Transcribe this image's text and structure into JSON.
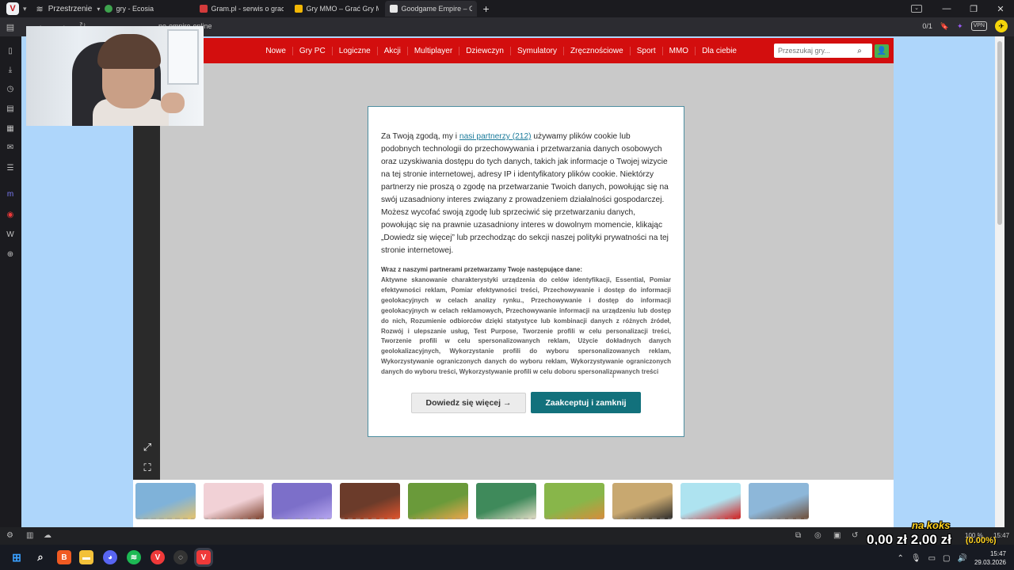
{
  "browser": {
    "workspace_label": "Przestrzenie",
    "tabs": [
      {
        "title": "gry - Ecosia",
        "color": "#3ea44e"
      },
      {
        "title": "Gram.pl - serwis o grach",
        "color": "#d33b3b"
      },
      {
        "title": "Gry MMO – Grać Gry MMO",
        "color": "#f2b705"
      },
      {
        "title": "Goodgame Empire – Grać C",
        "color": "#5a5a5a"
      }
    ],
    "url": "ne-empire-online",
    "tab_counter": "0/1",
    "vpn_label": "VPN"
  },
  "site": {
    "nav": [
      "Nowe",
      "Gry PC",
      "Logiczne",
      "Akcji",
      "Multiplayer",
      "Dziewczyn",
      "Symulatory",
      "Zręcznościowe",
      "Sport",
      "MMO",
      "Dla ciebie"
    ],
    "search_placeholder": "Przeszukaj gry..."
  },
  "cookie": {
    "intro_before": "Za Twoją zgodą, my i ",
    "partners_link": "nasi partnerzy (212)",
    "intro_after": " używamy plików cookie lub podobnych technologii do przechowywania i przetwarzania danych osobowych oraz uzyskiwania dostępu do tych danych, takich jak informacje o Twojej wizycie na tej stronie internetowej, adresy IP i identyfikatory plików cookie. Niektórzy partnerzy nie proszą o zgodę na przetwarzanie Twoich danych, powołując się na swój uzasadniony interes związany z prowadzeniem działalności gospodarczej. Możesz wycofać swoją zgodę lub sprzeciwić się przetwarzaniu danych, powołując się na prawnie uzasadniony interes w dowolnym momencie, klikając „Dowiedz się więcej” lub przechodząc do sekcji naszej polityki prywatności na tej stronie internetowej.",
    "data_title": "Wraz z naszymi partnerami przetwarzamy Twoje następujące dane:",
    "data_list": "Aktywne skanowanie charakterystyki urządzenia do celów identyfikacji, Essential, Pomiar efektywności reklam, Pomiar efektywności treści, Przechowywanie i dostęp do informacji geolokacyjnych w celach analizy rynku., Przechowywanie i dostęp do informacji geolokacyjnych w celach reklamowych, Przechowywanie informacji na urządzeniu lub dostęp do nich, Rozumienie odbiorców dzięki statystyce lub kombinacji danych z różnych źródeł, Rozwój i ulepszanie usług, Test Purpose, Tworzenie profili w celu personalizacji treści, Tworzenie profili w celu spersonalizowanych reklam, Użycie dokładnych danych geolokalizacyjnych, Wykorzystanie profili do wyboru spersonalizowanych reklam, Wykorzystywanie ograniczonych danych do wyboru reklam, Wykorzystywanie ograniczonych danych do wyboru treści, Wykorzystywanie profili w celu doboru spersonalizowanych treści",
    "btn_more": "Dowiedz się więcej →",
    "btn_accept": "Zaakceptuj i zamknij"
  },
  "thumbs": [
    {
      "color": "#7fb2d9",
      "accent": "#e9c46a"
    },
    {
      "color": "#f1d1d6",
      "accent": "#7b3f2a"
    },
    {
      "color": "#7c6fc9",
      "accent": "#b7a7f0"
    },
    {
      "color": "#6b3b2a",
      "accent": "#e2542d"
    },
    {
      "color": "#6a9a3a",
      "accent": "#f0a64b"
    },
    {
      "color": "#3f8a5b",
      "accent": "#e7e0c9"
    },
    {
      "color": "#88b64a",
      "accent": "#d98c3a"
    },
    {
      "color": "#c8a870",
      "accent": "#2a2a2a"
    },
    {
      "color": "#aee3f0",
      "accent": "#d31a1a"
    },
    {
      "color": "#8db7d9",
      "accent": "#6e4b33"
    }
  ],
  "stream": {
    "name": "na koks",
    "money": "0,00 zł  2,00 zł",
    "pct": "(0.00%)"
  },
  "statusbar": {
    "zoom": "100 %",
    "time": "15:47"
  },
  "taskbar": {
    "time": "15:47",
    "date": "29.03.2026"
  }
}
